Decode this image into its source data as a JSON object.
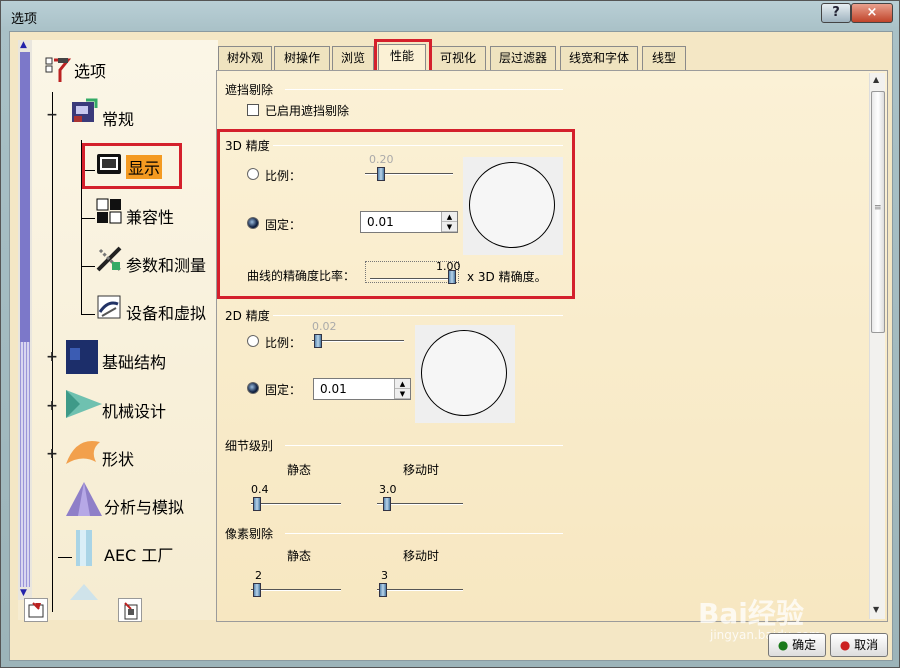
{
  "window": {
    "title": "选项",
    "help": "?",
    "close": "×"
  },
  "tree": {
    "root": "选项",
    "general": "常规",
    "items": [
      {
        "label": "显示"
      },
      {
        "label": "兼容性"
      },
      {
        "label": "参数和测量"
      },
      {
        "label": "设备和虚拟"
      }
    ],
    "categories": [
      {
        "label": "基础结构"
      },
      {
        "label": "机械设计"
      },
      {
        "label": "形状"
      },
      {
        "label": "分析与模拟"
      },
      {
        "label": "AEC 工厂"
      }
    ]
  },
  "tabs": [
    {
      "label": "树外观"
    },
    {
      "label": "树操作"
    },
    {
      "label": "浏览"
    },
    {
      "label": "性能",
      "active": true
    },
    {
      "label": "可视化"
    },
    {
      "label": "层过滤器"
    },
    {
      "label": "线宽和字体"
    },
    {
      "label": "线型"
    }
  ],
  "occlusion": {
    "title": "遮挡剔除",
    "checkbox": "已启用遮挡剔除",
    "checked": false
  },
  "precision3d": {
    "title": "3D 精度",
    "ratio_label": "比例：",
    "ratio_value": "0.20",
    "fixed_label": "固定：",
    "fixed_value": "0.01",
    "curve_label": "曲线的精确度比率：",
    "curve_value": "1.00",
    "curve_suffix": "x 3D 精确度。",
    "selected": "fixed"
  },
  "precision2d": {
    "title": "2D 精度",
    "ratio_label": "比例：",
    "ratio_value": "0.02",
    "fixed_label": "固定：",
    "fixed_value": "0.01",
    "selected": "fixed"
  },
  "lod": {
    "title": "细节级别",
    "static_label": "静态",
    "moving_label": "移动时",
    "static_value": "0.4",
    "moving_value": "3.0"
  },
  "pixel_culling": {
    "title": "像素剔除",
    "static_label": "静态",
    "moving_label": "移动时",
    "static_value": "2",
    "moving_value": "3"
  },
  "buttons": {
    "ok": "确定",
    "cancel": "取消"
  },
  "watermark": {
    "brand": "Bai经验",
    "url": "jingyan.baidu.com"
  }
}
